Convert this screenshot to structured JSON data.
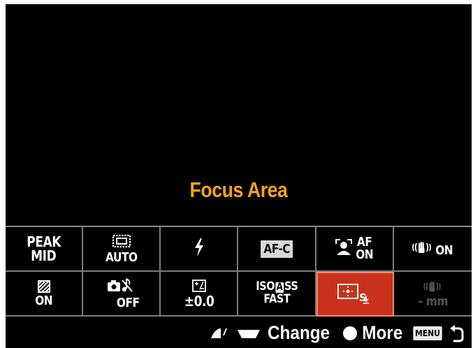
{
  "screen": {
    "title": "Focus Area"
  },
  "function_menu": {
    "row1": [
      {
        "top": "PEAK",
        "bottom": "MID"
      },
      {
        "icon": "drive-mode-frame-icon",
        "bottom": "AUTO"
      },
      {
        "icon": "flash-icon"
      },
      {
        "label": "AF-C"
      },
      {
        "icon": "face-detect-icon",
        "top": "AF",
        "bottom": "ON"
      },
      {
        "icon": "steadyshot-hand-icon",
        "bottom": "ON"
      }
    ],
    "row2": [
      {
        "icon": "zebra-icon",
        "bottom": "ON"
      },
      {
        "icon": "camera-music-mute-icon",
        "bottom": "OFF"
      },
      {
        "icon": "exposure-comp-icon",
        "bottom": "±0.0"
      },
      {
        "top_a": "ISO",
        "top_b": "A",
        "top_c": "SS",
        "bottom": "FAST"
      },
      {
        "icon": "focus-area-spot-icon",
        "selected": true
      },
      {
        "icon": "steadyshot-hand-icon",
        "bottom": "– mm",
        "dim": true
      }
    ]
  },
  "footer": {
    "change_label": "Change",
    "more_label": "More",
    "menu_label": "MENU"
  },
  "colors": {
    "title": "#f6a21b",
    "selected": "#c8321d"
  }
}
